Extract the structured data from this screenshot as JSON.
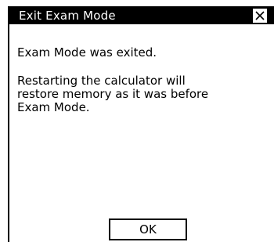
{
  "dialog": {
    "title": "Exit Exam Mode",
    "close_icon": "close-icon",
    "message_line1": "Exam Mode was exited.",
    "message_line2": "Restarting the calculator will\nrestore memory as it was before\nExam Mode.",
    "ok_label": "OK"
  },
  "colors": {
    "title_bar_bg": "#000000",
    "title_text": "#ffffff",
    "background": "#ffffff"
  }
}
